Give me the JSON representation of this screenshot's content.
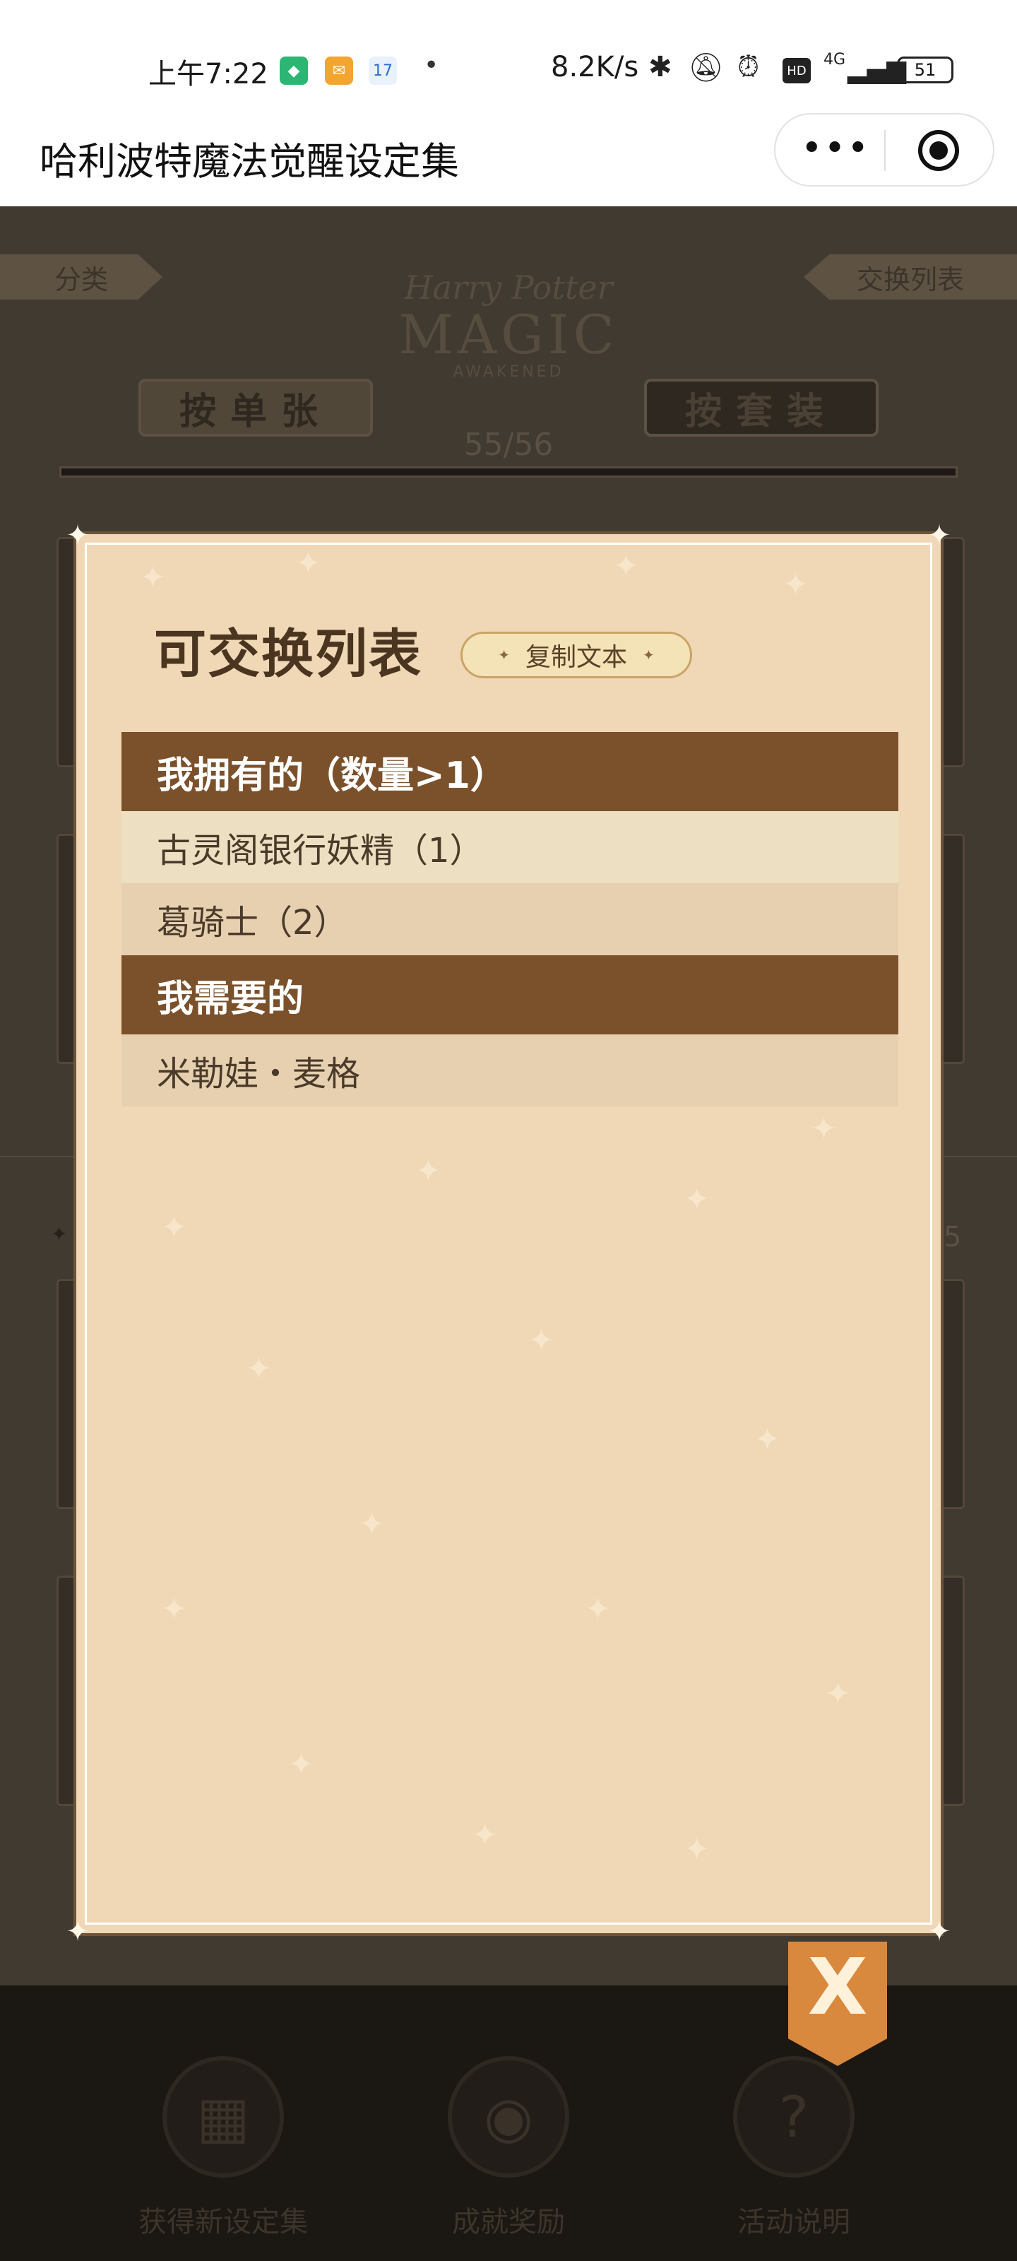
{
  "status_bar": {
    "time": "上午7:22",
    "calendar_day": "17",
    "dot": "•",
    "net_speed": "8.2K/s",
    "network": "4G",
    "battery": "51"
  },
  "title_bar": {
    "title": "哈利波特魔法觉醒设定集",
    "more_icon": "•••"
  },
  "background": {
    "category_label": "分类",
    "exchange_list_label": "交换列表",
    "logo_line1": "Harry Potter",
    "logo_line2": "MAGIC",
    "logo_line3": "AWAKENED",
    "tab_single": "按单张",
    "tab_set": "按套装",
    "count": "55/56",
    "right_edge_count": "5",
    "nav": [
      {
        "label": "获得新设定集",
        "icon": "card-icon"
      },
      {
        "label": "成就奖励",
        "icon": "owl-icon"
      },
      {
        "label": "活动说明",
        "icon": "question-icon",
        "glyph": "?"
      }
    ]
  },
  "modal": {
    "title": "可交换列表",
    "copy_button": "复制文本",
    "have_header": "我拥有的（数量>1）",
    "have_items": [
      "古灵阁银行妖精（1）",
      "葛骑士（2）"
    ],
    "need_header": "我需要的",
    "need_items": [
      "米勒娃・麦格"
    ],
    "close_glyph": "X"
  },
  "colors": {
    "accent": "#7b512b",
    "modal_bg": "#f0d8b6",
    "close_button": "#d9893e"
  }
}
